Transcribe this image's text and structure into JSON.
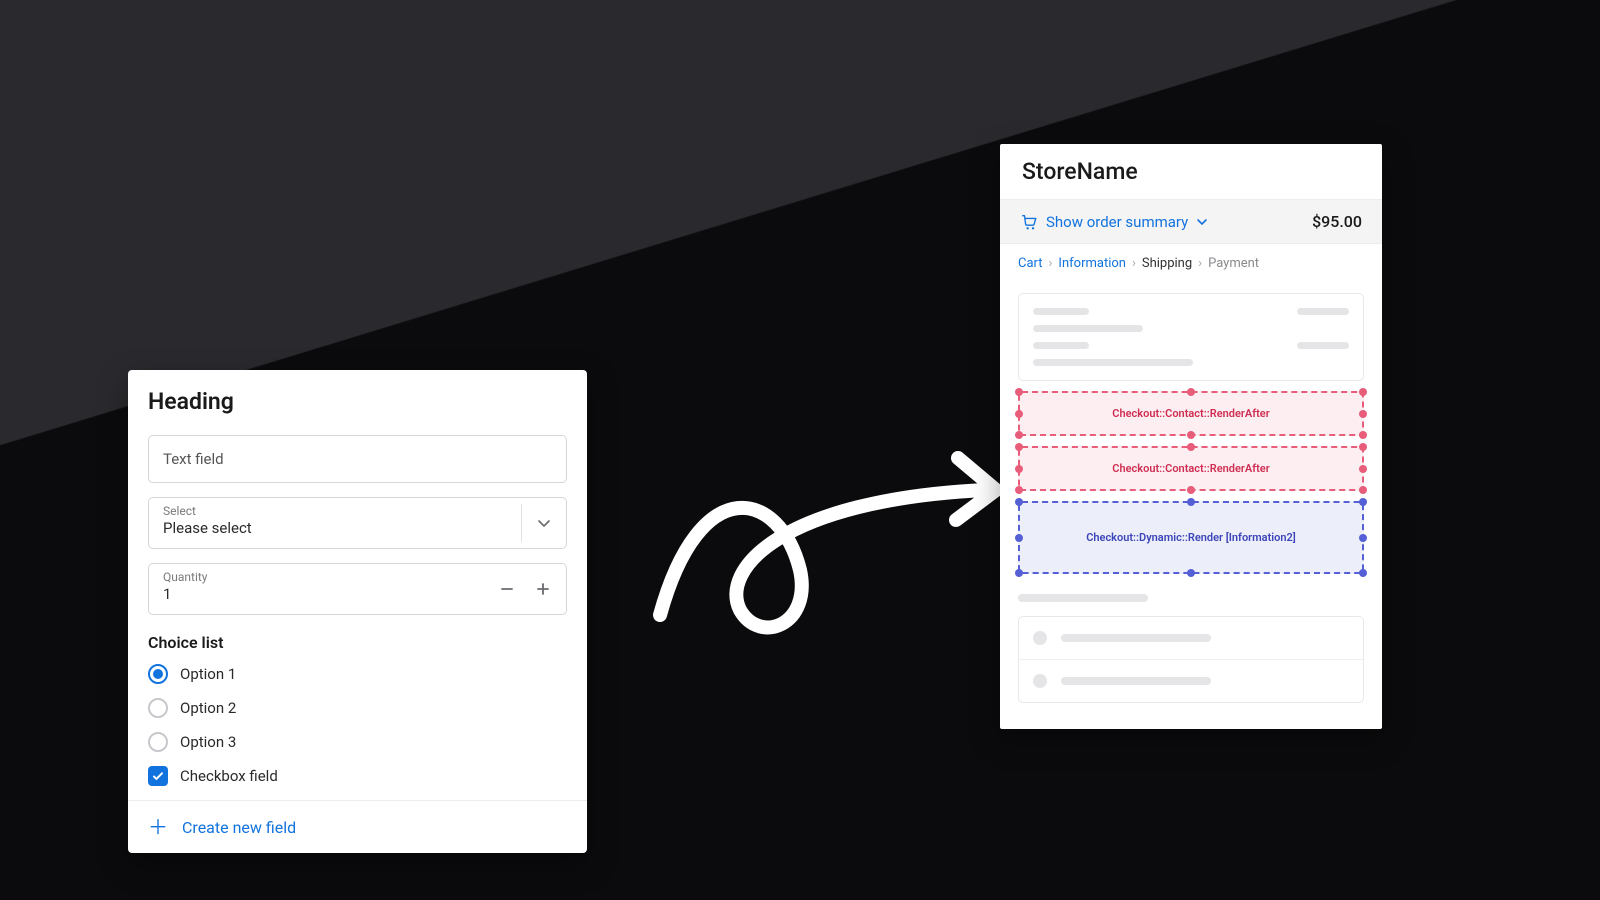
{
  "formPanel": {
    "heading": "Heading",
    "text_field_placeholder": "Text field",
    "select": {
      "label": "Select",
      "value": "Please select"
    },
    "quantity": {
      "label": "Quantity",
      "value": "1"
    },
    "choice_list_label": "Choice list",
    "options": [
      {
        "label": "Option 1",
        "selected": true
      },
      {
        "label": "Option 2",
        "selected": false
      },
      {
        "label": "Option 3",
        "selected": false
      }
    ],
    "checkbox": {
      "label": "Checkbox field",
      "checked": true
    },
    "create_new_field": "Create new field"
  },
  "checkoutPanel": {
    "store_name": "StoreName",
    "summary_toggle": "Show order summary",
    "total": "$95.00",
    "breadcrumbs": {
      "cart": "Cart",
      "information": "Information",
      "shipping": "Shipping",
      "payment": "Payment"
    },
    "zones": {
      "contact_after_1": "Checkout::Contact::RenderAfter",
      "contact_after_2": "Checkout::Contact::RenderAfter",
      "dynamic_render": "Checkout::Dynamic::Render [Information2]"
    }
  }
}
